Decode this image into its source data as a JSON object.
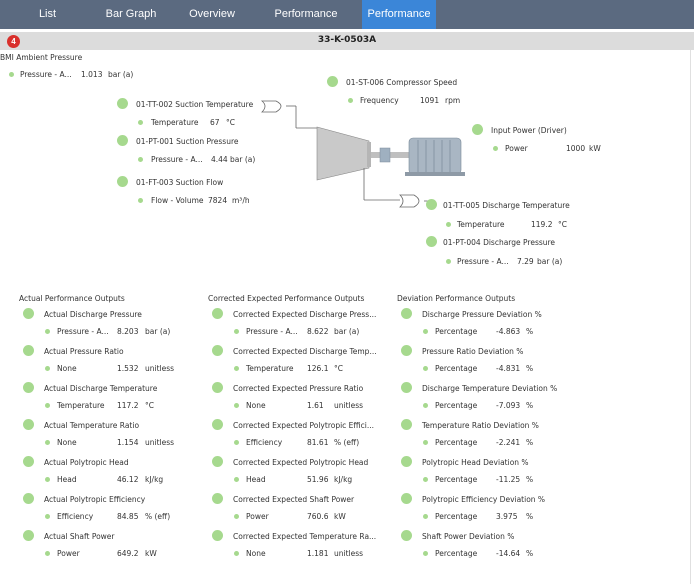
{
  "tabs": [
    {
      "label": "List",
      "active": false
    },
    {
      "label": "Bar Graph",
      "active": false
    },
    {
      "label": "Overview",
      "active": false
    },
    {
      "label": "Performance Overview",
      "active": false
    },
    {
      "label": "Performance",
      "active": true
    }
  ],
  "header": {
    "badge": "4",
    "equipment_tag": "33-K-0503A"
  },
  "ambient": {
    "title": "BMI Ambient Pressure",
    "label": "Pressure - A...",
    "value": "1.013",
    "unit": "bar (a)"
  },
  "sensors": [
    {
      "title": "01-TT-002 Suction Temperature",
      "label": "Temperature",
      "value": "67",
      "unit": "°C"
    },
    {
      "title": "01-PT-001 Suction Pressure",
      "label": "Pressure - A...",
      "value": "4.44",
      "unit": "bar (a)"
    },
    {
      "title": "01-FT-003 Suction Flow",
      "label": "Flow - Volume",
      "value": "7824",
      "unit": "m³/h"
    },
    {
      "title": "01-ST-006 Compressor Speed",
      "label": "Frequency",
      "value": "1091",
      "unit": "rpm"
    },
    {
      "title": "Input Power (Driver)",
      "label": "Power",
      "value": "1000",
      "unit": "kW"
    },
    {
      "title": "01-TT-005 Discharge Temperature",
      "label": "Temperature",
      "value": "119.2",
      "unit": "°C"
    },
    {
      "title": "01-PT-004 Discharge Pressure",
      "label": "Pressure - A...",
      "value": "7.29",
      "unit": "bar (a)"
    }
  ],
  "sections": [
    {
      "header": "Actual Performance Outputs",
      "items": [
        {
          "title": "Actual Discharge Pressure",
          "label": "Pressure - A...",
          "value": "8.203",
          "unit": "bar (a)"
        },
        {
          "title": "Actual Pressure Ratio",
          "label": "None",
          "value": "1.532",
          "unit": "unitless"
        },
        {
          "title": "Actual Discharge Temperature",
          "label": "Temperature",
          "value": "117.2",
          "unit": "°C"
        },
        {
          "title": "Actual Temperature Ratio",
          "label": "None",
          "value": "1.154",
          "unit": "unitless"
        },
        {
          "title": "Actual Polytropic Head",
          "label": "Head",
          "value": "46.12",
          "unit": "kJ/kg"
        },
        {
          "title": "Actual Polytropic Efficiency",
          "label": "Efficiency",
          "value": "84.85",
          "unit": "% (eff)"
        },
        {
          "title": "Actual Shaft Power",
          "label": "Power",
          "value": "649.2",
          "unit": "kW"
        }
      ]
    },
    {
      "header": "Corrected Expected Performance Outputs",
      "items": [
        {
          "title": "Corrected Expected Discharge Press...",
          "label": "Pressure - A...",
          "value": "8.622",
          "unit": "bar (a)"
        },
        {
          "title": "Corrected Expected Discharge Temp...",
          "label": "Temperature",
          "value": "126.1",
          "unit": "°C"
        },
        {
          "title": "Corrected Expected Pressure Ratio",
          "label": "None",
          "value": "1.61",
          "unit": "unitless"
        },
        {
          "title": "Corrected Expected Polytropic Effici...",
          "label": "Efficiency",
          "value": "81.61",
          "unit": "% (eff)"
        },
        {
          "title": "Corrected Expected Polytropic Head",
          "label": "Head",
          "value": "51.96",
          "unit": "kJ/kg"
        },
        {
          "title": "Corrected Expected Shaft Power",
          "label": "Power",
          "value": "760.6",
          "unit": "kW"
        },
        {
          "title": "Corrected Expected Temperature Ra...",
          "label": "None",
          "value": "1.181",
          "unit": "unitless"
        }
      ]
    },
    {
      "header": "Deviation Performance Outputs",
      "items": [
        {
          "title": "Discharge Pressure Deviation %",
          "label": "Percentage",
          "value": "-4.863",
          "unit": "%"
        },
        {
          "title": "Pressure Ratio Deviation %",
          "label": "Percentage",
          "value": "-4.831",
          "unit": "%"
        },
        {
          "title": "Discharge Temperature Deviation %",
          "label": "Percentage",
          "value": "-7.093",
          "unit": "%"
        },
        {
          "title": "Temperature Ratio Deviation %",
          "label": "Percentage",
          "value": "-2.241",
          "unit": "%"
        },
        {
          "title": "Polytropic Head Deviation %",
          "label": "Percentage",
          "value": "-11.25",
          "unit": "%"
        },
        {
          "title": "Polytropic Efficiency Deviation %",
          "label": "Percentage",
          "value": "3.975",
          "unit": "%"
        },
        {
          "title": "Shaft Power Deviation %",
          "label": "Percentage",
          "value": "-14.64",
          "unit": "%"
        }
      ]
    }
  ],
  "colors": {
    "tabbar": "#5b6a80",
    "active_tab": "#3b86d8",
    "status_green": "#a6d98e",
    "badge_red": "#d9302c"
  }
}
